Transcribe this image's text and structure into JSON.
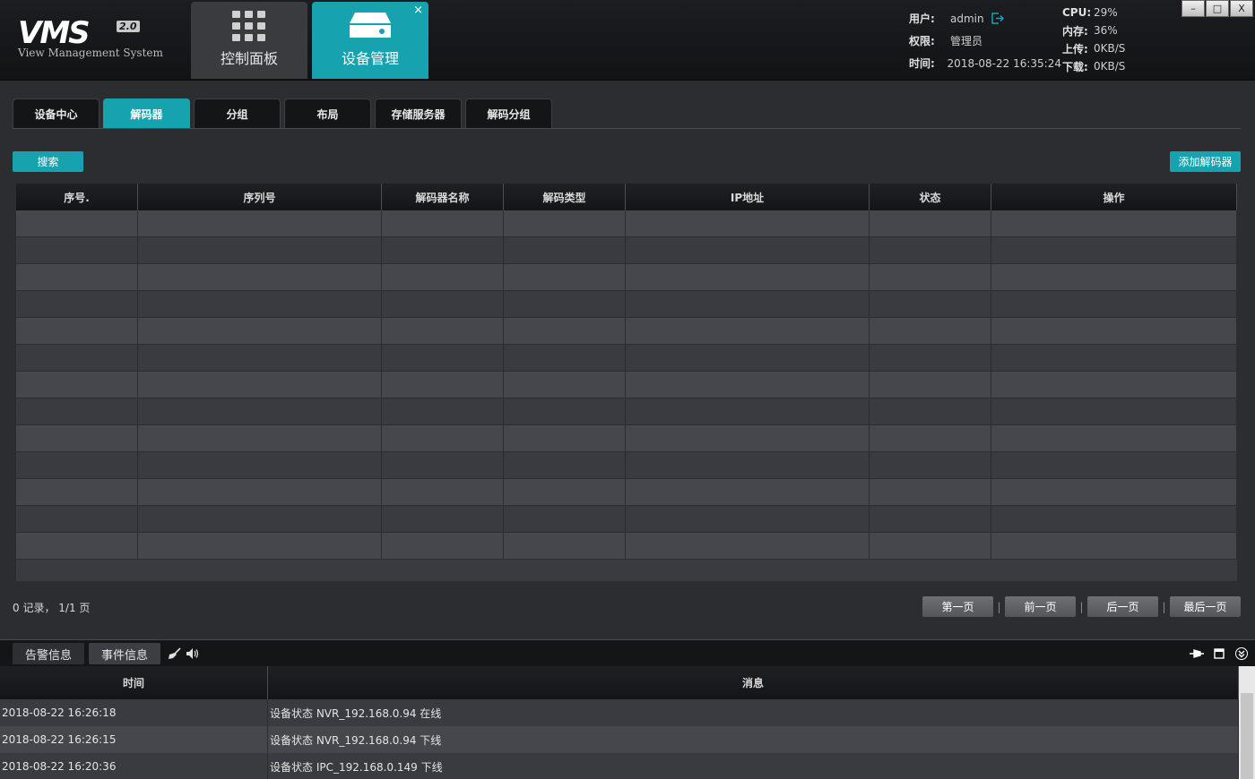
{
  "brand": {
    "logo": "VMS",
    "version": "2.0",
    "subtitle": "View Management System"
  },
  "nav": {
    "tabs": [
      {
        "label": "控制面板",
        "icon": "grid-icon"
      },
      {
        "label": "设备管理",
        "icon": "server-icon"
      }
    ],
    "close": "×"
  },
  "user_info": {
    "user_label": "用户:",
    "user": "admin",
    "role_label": "权限:",
    "role": "管理员",
    "time_label": "时间:",
    "time": "2018-08-22 16:35:24"
  },
  "stats": {
    "cpu_label": "CPU:",
    "cpu": "29%",
    "mem_label": "内存:",
    "mem": "36%",
    "up_label": "上传:",
    "up": "0KB/S",
    "down_label": "下载:",
    "down": "0KB/S"
  },
  "window_controls": {
    "minimize": "–",
    "maximize": "□",
    "close": "X"
  },
  "subtabs": [
    "设备中心",
    "解码器",
    "分组",
    "布局",
    "存储服务器",
    "解码分组"
  ],
  "toolbar": {
    "search": "搜索",
    "add": "添加解码器"
  },
  "decoder_table": {
    "columns": [
      "序号.",
      "序列号",
      "解码器名称",
      "解码类型",
      "IP地址",
      "状态",
      "操作"
    ]
  },
  "pagination": {
    "records": "0 记录，  1/1 页",
    "first": "第一页",
    "prev": "前一页",
    "next": "后一页",
    "last": "最后一页",
    "sep": "|"
  },
  "bottom_tabs": {
    "alarm": "告警信息",
    "event": "事件信息"
  },
  "log_table": {
    "columns": {
      "time": "时间",
      "message": "消息"
    },
    "rows": [
      {
        "time": "2018-08-22 16:26:18",
        "message": "设备状态 NVR_192.168.0.94 在线"
      },
      {
        "time": "2018-08-22 16:26:15",
        "message": "设备状态 NVR_192.168.0.94 下线"
      },
      {
        "time": "2018-08-22 16:20:36",
        "message": "设备状态 IPC_192.168.0.149 下线"
      }
    ]
  },
  "colors": {
    "accent": "#17a2b0",
    "background": "#2c2d31",
    "header": "#141517"
  }
}
